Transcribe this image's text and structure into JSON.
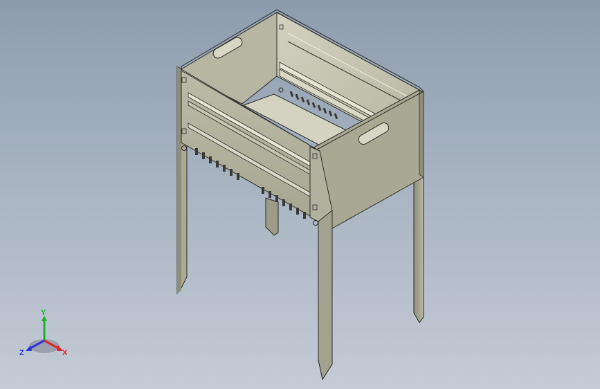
{
  "viewport": {
    "background_top": "#8d9cad",
    "background_bottom": "#c4cbd6"
  },
  "model": {
    "body_color": "#b4b39e",
    "body_shadow": "#8e8d79",
    "inner_color": "#c9c8b5",
    "edge_color": "#2a2a26"
  },
  "triad": {
    "x_label": "X",
    "y_label": "Y",
    "z_label": "Z",
    "x_color": "#e0242a",
    "y_color": "#20b028",
    "z_color": "#2a35d8"
  }
}
